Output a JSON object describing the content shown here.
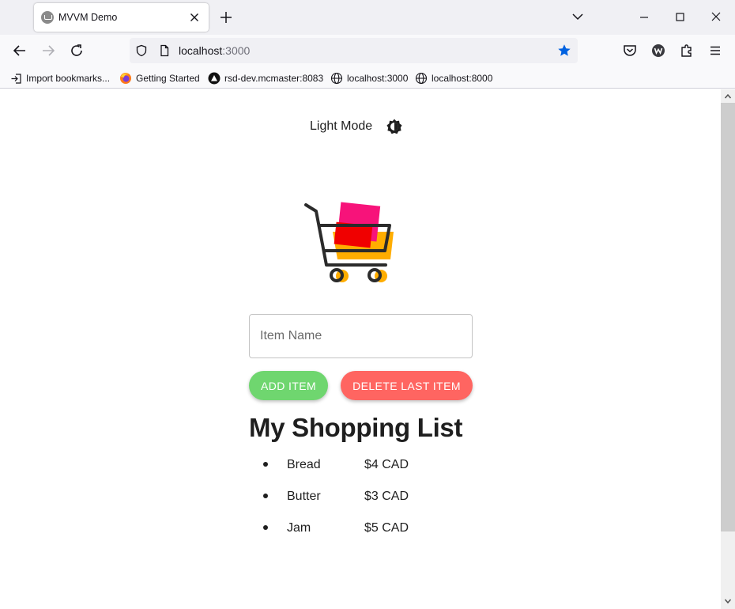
{
  "browser": {
    "tab": {
      "title": "MVVM Demo",
      "favicon": "cart-favicon"
    },
    "url": {
      "host": "localhost",
      "port": ":3000"
    },
    "bookmarks": [
      {
        "label": "Import bookmarks...",
        "icon": "import-icon"
      },
      {
        "label": "Getting Started",
        "icon": "firefox-icon"
      },
      {
        "label": "rsd-dev.mcmaster:8083",
        "icon": "triangle-logo-icon"
      },
      {
        "label": "localhost:3000",
        "icon": "globe-icon"
      },
      {
        "label": "localhost:8000",
        "icon": "globe-icon"
      }
    ]
  },
  "page": {
    "theme_toggle": {
      "label": "Light Mode",
      "icon": "contrast-sun-icon"
    },
    "logo": "shopping-cart-logo",
    "input": {
      "placeholder": "Item Name",
      "value": ""
    },
    "buttons": {
      "add": {
        "label": "ADD ITEM",
        "color": "#6fd66f"
      },
      "delete": {
        "label": "DELETE LAST ITEM",
        "color": "#ff6561"
      }
    },
    "list_title": "My Shopping List",
    "items": [
      {
        "name": "Bread",
        "price": "$4 CAD"
      },
      {
        "name": "Butter",
        "price": "$3 CAD"
      },
      {
        "name": "Jam",
        "price": "$5 CAD"
      }
    ]
  },
  "colors": {
    "accent_star": "#0061e0",
    "logo_pink": "#f7137a",
    "logo_red": "#f00000",
    "logo_orange": "#ffad00"
  }
}
